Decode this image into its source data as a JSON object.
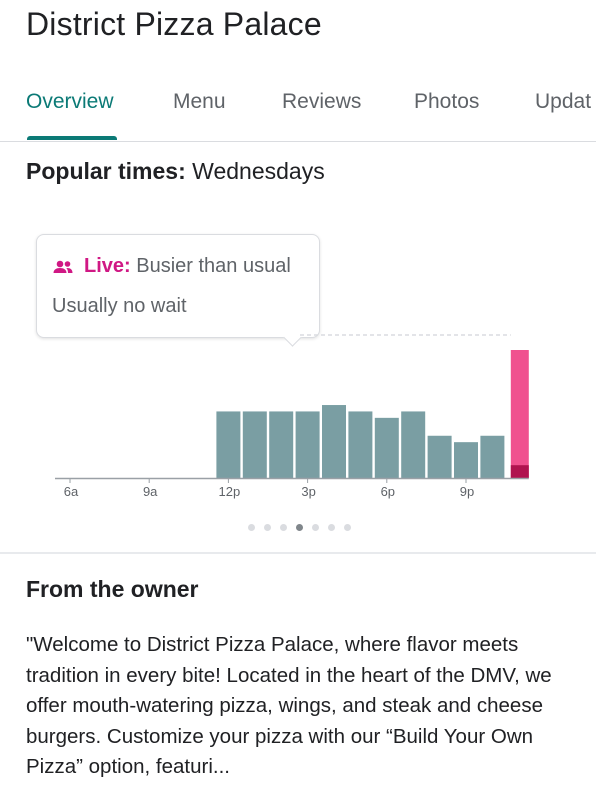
{
  "place": {
    "name": "District Pizza Palace"
  },
  "tabs": [
    {
      "label": "Overview",
      "active": true
    },
    {
      "label": "Menu",
      "active": false
    },
    {
      "label": "Reviews",
      "active": false
    },
    {
      "label": "Photos",
      "active": false
    },
    {
      "label": "Updat",
      "active": false
    }
  ],
  "popular_times": {
    "label": "Popular times:",
    "day": "Wednesdays",
    "live_icon": "people-icon",
    "live_label": "Live:",
    "live_status": "Busier than usual",
    "wait": "Usually no wait",
    "page_dots": 7,
    "active_dot": 3
  },
  "chart_data": {
    "type": "bar",
    "x_tick_labels": [
      "6a",
      "9a",
      "12p",
      "3p",
      "6p",
      "9p"
    ],
    "categories": [
      "6a",
      "7a",
      "8a",
      "9a",
      "10a",
      "11a",
      "12p",
      "1p",
      "2p",
      "3p",
      "4p",
      "5p",
      "6p",
      "7p",
      "8p",
      "9p",
      "10p",
      "11p"
    ],
    "values": [
      0,
      0,
      0,
      0,
      0,
      0,
      52,
      52,
      52,
      52,
      57,
      52,
      47,
      52,
      33,
      28,
      33,
      14
    ],
    "live": {
      "category": "11p",
      "usual": 10,
      "live": 100
    },
    "ylim": [
      0,
      100
    ],
    "colors": {
      "bar": "#7a9ea3",
      "live": "#f0518f",
      "live_usual": "#b0134f",
      "baseline": "#9aa0a6",
      "dashed": "#dadce0"
    }
  },
  "owner": {
    "heading": "From the owner",
    "text": "\"Welcome to District Pizza Palace, where flavor meets tradition in every bite! Located in the heart of the DMV, we offer mouth-watering pizza, wings, and steak and cheese burgers. Customize your pizza with our “Build Your Own Pizza” option, featuri..."
  },
  "colors": {
    "accent": "#0b7a76",
    "live": "#d01884"
  }
}
